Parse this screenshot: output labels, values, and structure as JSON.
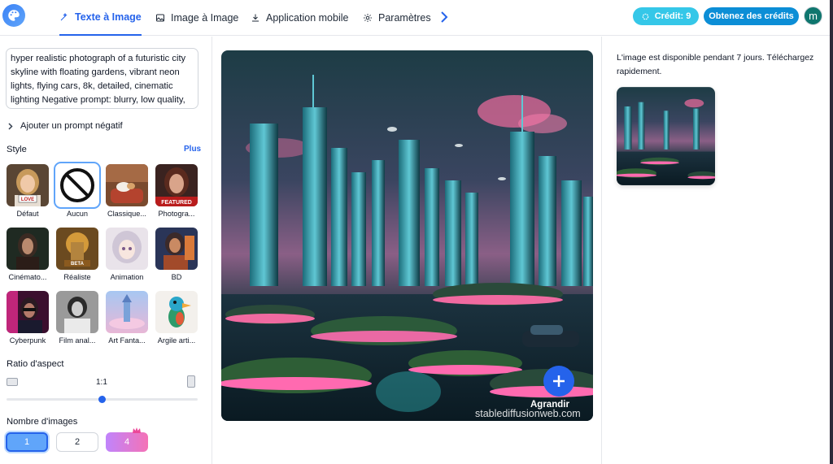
{
  "topbar": {
    "tabs": [
      {
        "label": "Texte à Image",
        "icon": "wand-icon",
        "active": true
      },
      {
        "label": "Image à Image",
        "icon": "image-icon",
        "active": false
      },
      {
        "label": "Application mobile",
        "icon": "download-icon",
        "active": false
      },
      {
        "label": "Paramètres",
        "icon": "gear-icon",
        "active": false
      }
    ],
    "credit_label": "Crédit: 9",
    "get_credits_label": "Obtenez des crédits",
    "avatar_initial": "m",
    "colors": {
      "accent": "#2563eb",
      "credit_pill": "#35c7e8",
      "get_credits": "#0c8ed6"
    }
  },
  "left": {
    "prompt_text": "hyper realistic photograph of a futuristic city skyline with floating gardens, vibrant neon lights, flying cars, 8k, detailed, cinematic lighting Negative prompt: blurry, low quality, distorted,",
    "negative_prompt_label": "Ajouter un prompt négatif",
    "style_label": "Style",
    "more_label": "Plus",
    "styles": [
      {
        "name": "Défaut",
        "selected": false,
        "thumb_text": "LOVE"
      },
      {
        "name": "Aucun",
        "selected": true
      },
      {
        "name": "Classique...",
        "selected": false
      },
      {
        "name": "Photogra...",
        "selected": false,
        "thumb_text": "FEATURED"
      },
      {
        "name": "Cinémato...",
        "selected": false
      },
      {
        "name": "Réaliste",
        "selected": false,
        "thumb_text": "BETA"
      },
      {
        "name": "Animation",
        "selected": false
      },
      {
        "name": "BD",
        "selected": false
      },
      {
        "name": "Cyberpunk",
        "selected": false
      },
      {
        "name": "Film anal...",
        "selected": false
      },
      {
        "name": "Art Fanta...",
        "selected": false
      },
      {
        "name": "Argile arti...",
        "selected": false
      }
    ],
    "ratio_label": "Ratio d'aspect",
    "ratio_value": "1:1",
    "ratio_slider_fraction": 0.5,
    "count_label": "Nombre d'images",
    "counts": [
      {
        "label": "1",
        "active": true
      },
      {
        "label": "2",
        "active": false
      },
      {
        "label": "4",
        "active": false,
        "premium": true
      }
    ]
  },
  "center": {
    "upscale_label": "Agrandir",
    "watermark": "stablediffusionweb.com"
  },
  "right": {
    "availability_text": "L'image est disponible pendant 7 jours. Téléchargez rapidement."
  }
}
